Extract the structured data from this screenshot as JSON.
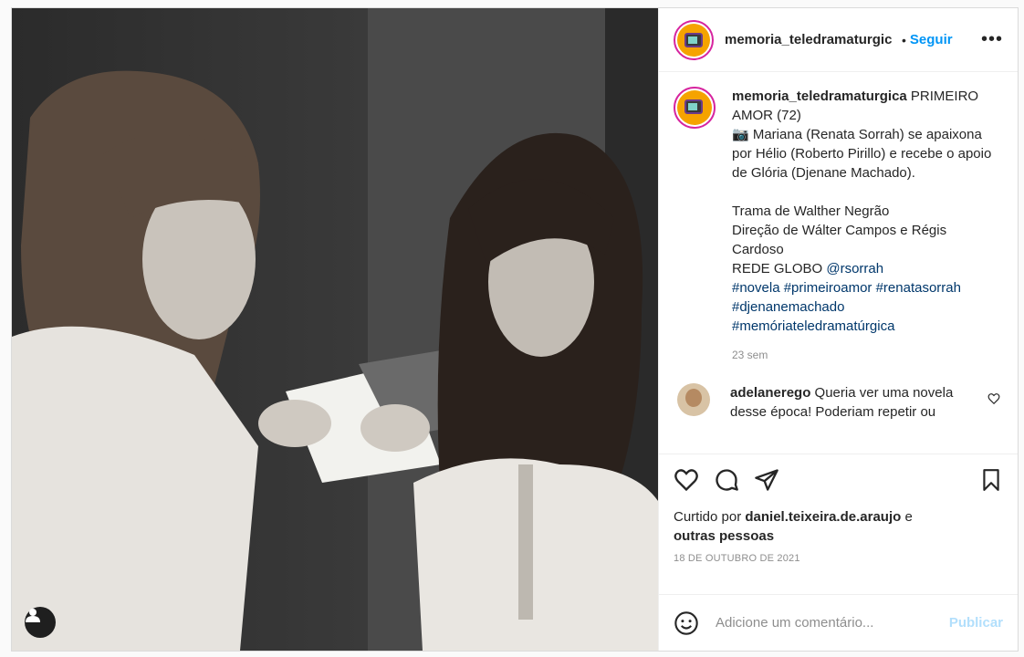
{
  "post": {
    "image_alt": "Black and white still of two women reading a letter"
  },
  "header": {
    "username": "memoria_teledramaturgic",
    "separator": "•",
    "follow_label": "Seguir",
    "more_label": "•••"
  },
  "caption": {
    "username": "memoria_teledramaturgica",
    "line1": " PRIMEIRO AMOR (72)",
    "line2": "📷 Mariana (Renata Sorrah) se apaixona por Hélio (Roberto Pirillo) e recebe o apoio de Glória (Djenane Machado).",
    "line3": "Trama de Walther Negrão",
    "line4": "Direção de Wálter Campos e Régis Cardoso",
    "line5": "REDE GLOBO ",
    "mention": "@rsorrah",
    "hashtags": "#novela #primeiroamor #renatasorrah #djenanemachado #memóriateledramatúrgica",
    "time": "23 sem"
  },
  "comment": {
    "username": "adelanerego",
    "text": " Queria ver uma novela desse época! Poderiam repetir ou deixar no globo play"
  },
  "likes": {
    "prefix": "Curtido por ",
    "user": "daniel.teixeira.de.araujo",
    "mid": " e",
    "others": "outras pessoas"
  },
  "date": "18 DE OUTUBRO DE 2021",
  "add_comment": {
    "placeholder": "Adicione um comentário...",
    "publish_label": "Publicar"
  }
}
